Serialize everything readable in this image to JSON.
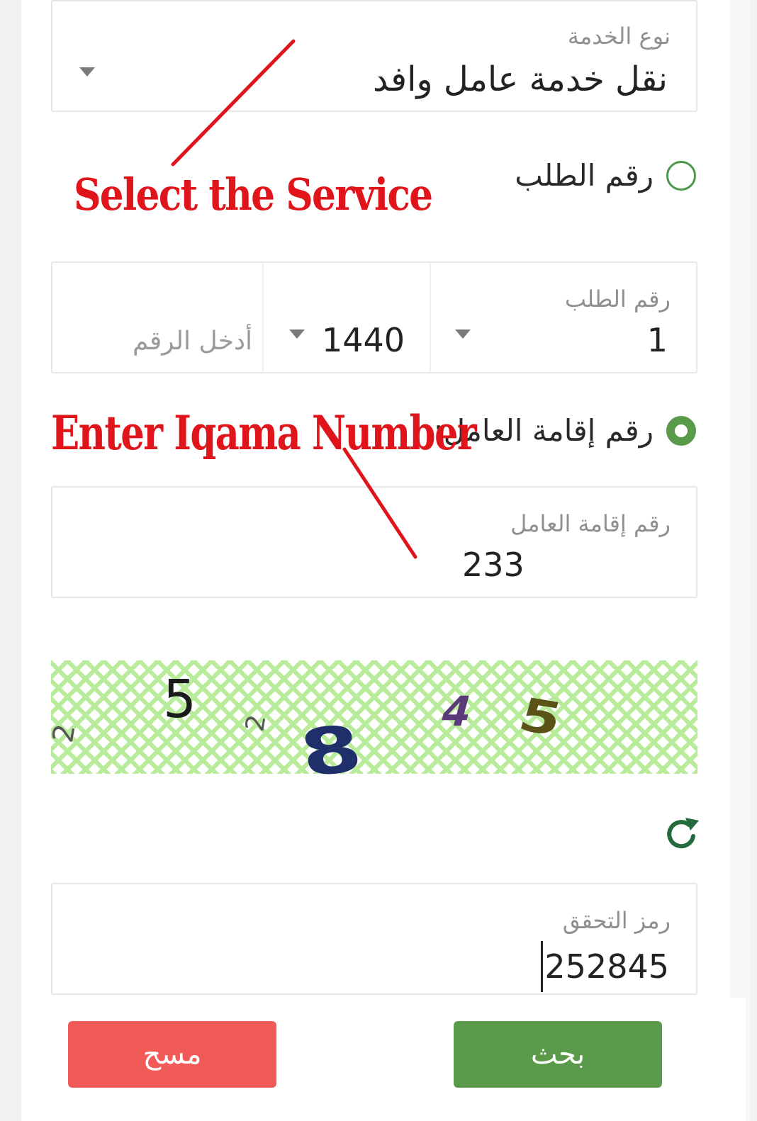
{
  "service_type": {
    "label": "نوع الخدمة",
    "value": "نقل خدمة عامل وافد"
  },
  "radio_request_number": {
    "label": "رقم الطلب",
    "checked": false
  },
  "request_number_field": {
    "label": "رقم الطلب",
    "number_value": "1",
    "year_value": "1440",
    "input_placeholder": "أدخل الرقم"
  },
  "radio_iqama": {
    "label": "رقم إقامة العامل:",
    "checked": true
  },
  "iqama_field": {
    "label": "رقم إقامة العامل",
    "value": "233"
  },
  "captcha": {
    "digits": [
      "2",
      "5",
      "2",
      "8",
      "4",
      "5"
    ],
    "refresh_icon": "refresh-icon"
  },
  "verification_field": {
    "label": "رمز التحقق",
    "value": "252845"
  },
  "buttons": {
    "clear_label": "مسح",
    "search_label": "بحث"
  },
  "annotations": {
    "select_service": "Select the Service",
    "enter_iqama": "Enter Iqama Number"
  },
  "colors": {
    "accent_green": "#5b9a4a",
    "clear_red": "#f05a57",
    "annotation_red": "#e0141b"
  }
}
